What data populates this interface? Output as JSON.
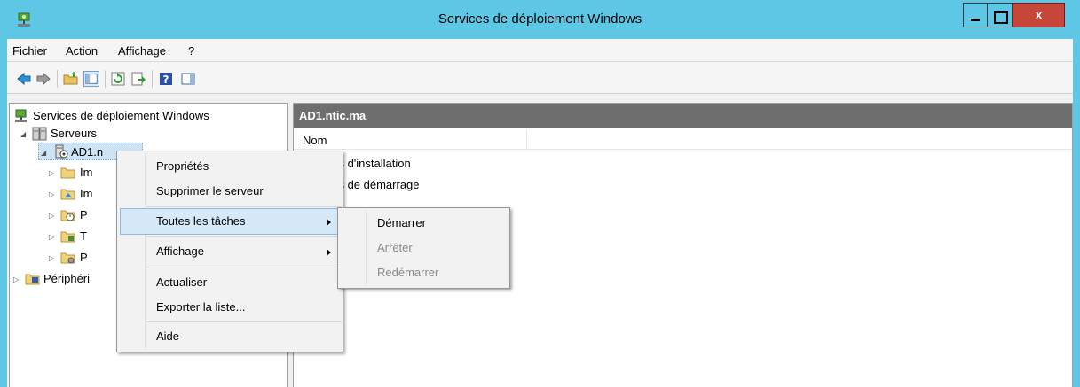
{
  "window": {
    "title": "Services de déploiement Windows",
    "close_label": "x"
  },
  "menubar": {
    "items": [
      "Fichier",
      "Action",
      "Affichage",
      "?"
    ]
  },
  "toolbar": {
    "icons": [
      "back-arrow-icon",
      "forward-arrow-icon",
      "folder-up-icon",
      "show-hide-console-tree-icon",
      "refresh-icon",
      "export-list-icon",
      "help-icon",
      "show-hide-action-pane-icon"
    ]
  },
  "tree": {
    "root": "Services de déploiement Windows",
    "servers": "Serveurs",
    "server_node": "AD1.n",
    "children": [
      "Im",
      "Im",
      "P",
      "T",
      "P"
    ],
    "devices": "Périphéri"
  },
  "right_pane": {
    "header": "AD1.ntic.ma",
    "column_name": "Nom",
    "items": [
      "ges d'installation",
      "ges de démarrage"
    ]
  },
  "context_menu": {
    "items": {
      "properties": "Propriétés",
      "remove_server": "Supprimer le serveur",
      "all_tasks": "Toutes les tâches",
      "view": "Affichage",
      "refresh": "Actualiser",
      "export": "Exporter la liste...",
      "help": "Aide"
    }
  },
  "submenu": {
    "items": {
      "start": "Démarrer",
      "stop": "Arrêter",
      "restart": "Redémarrer"
    }
  },
  "colors": {
    "titlebar": "#5fc7e6",
    "close_button": "#c7463a",
    "pane_header": "#6e6e6e",
    "highlight": "#d5e9f9"
  }
}
